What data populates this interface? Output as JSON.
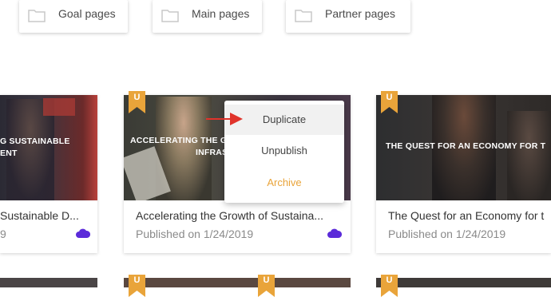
{
  "folders": [
    {
      "label": "Goal pages",
      "icon": "folder-icon"
    },
    {
      "label": "Main pages",
      "icon": "folder-icon"
    },
    {
      "label": "Partner pages",
      "icon": "folder-icon"
    }
  ],
  "cards": [
    {
      "overlay": "G SUSTAINABLE\nENT",
      "title": "Sustainable D...",
      "subtitle": "9",
      "badge": ""
    },
    {
      "overlay": "ACCELERATING THE G\nINFRAS",
      "title": "Accelerating the Growth of Sustaina...",
      "subtitle": "Published on 1/24/2019",
      "badge": "U"
    },
    {
      "overlay": "THE QUEST FOR AN ECONOMY FOR T",
      "title": "The Quest for an Economy for t",
      "subtitle": "Published on 1/24/2019",
      "badge": "U"
    }
  ],
  "context_menu": {
    "items": [
      "Duplicate",
      "Unpublish",
      "Archive"
    ]
  },
  "bottom_badges": [
    "U",
    "U",
    "U"
  ],
  "colors": {
    "accent": "#e9a43a",
    "arrow": "#e0332b",
    "cloud": "#5b2bd9"
  }
}
